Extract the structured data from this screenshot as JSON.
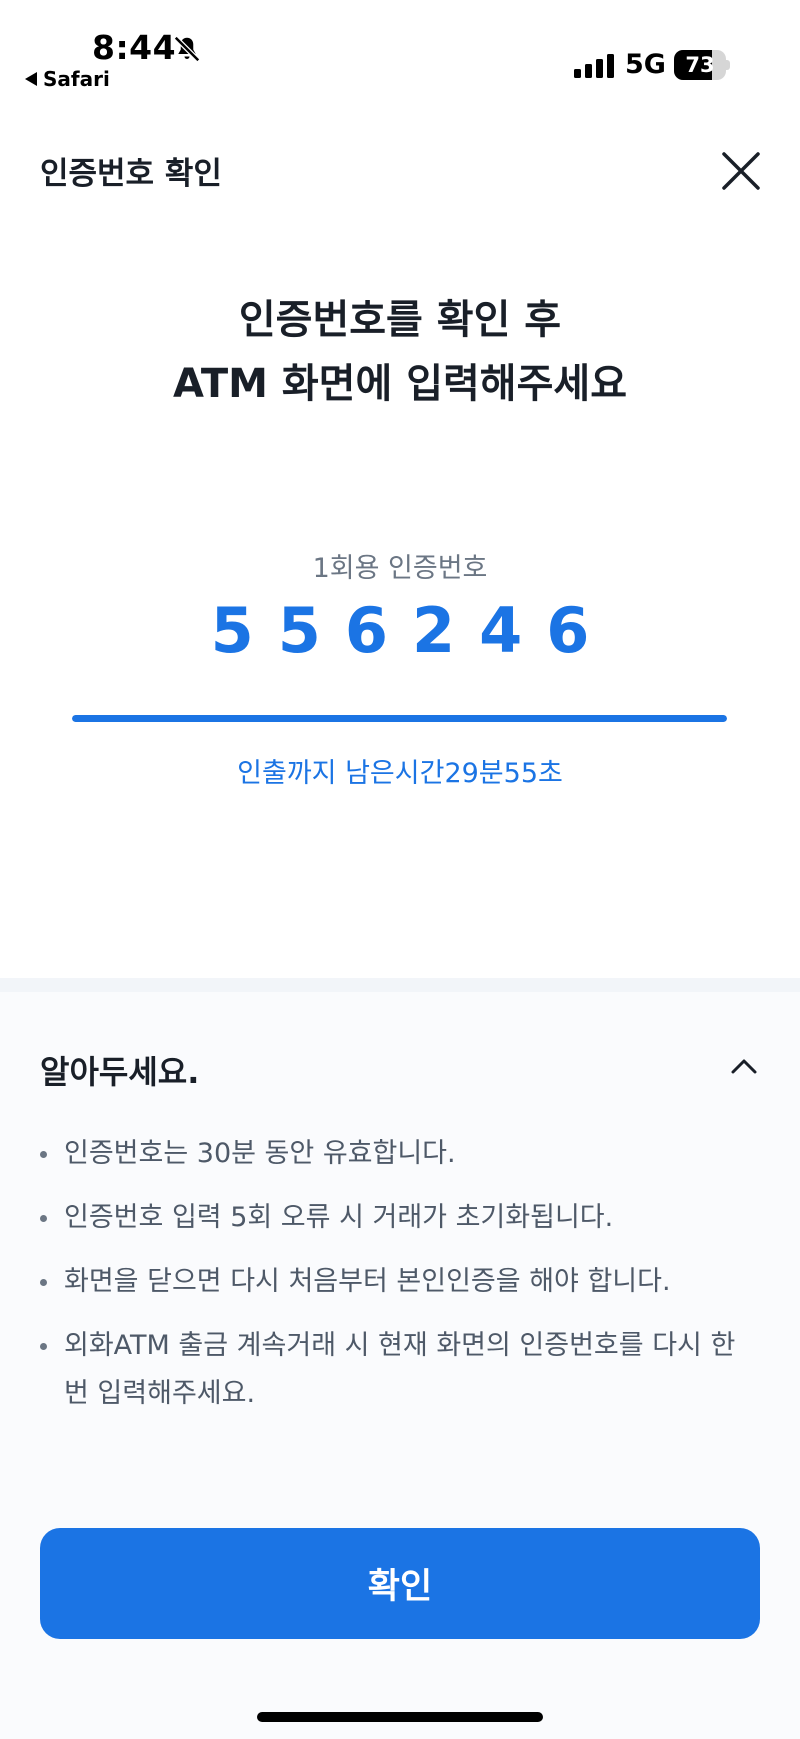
{
  "status_bar": {
    "time": "8:44",
    "back_app": "Safari",
    "network": "5G",
    "battery": "73",
    "battery_level": 0.73,
    "silent_icon": "bell-slash-icon",
    "signal_icon": "cellular-signal-icon"
  },
  "header": {
    "title": "인증번호 확인",
    "close_icon": "close-icon"
  },
  "headline": {
    "line1": "인증번호를 확인 후",
    "line2": "ATM 화면에 입력해주세요"
  },
  "code": {
    "label": "1회용 인증번호",
    "value": "556246"
  },
  "timer": {
    "text": "인출까지 남은시간29분55초",
    "progress": 1.0
  },
  "notice": {
    "title": "알아두세요.",
    "toggle_icon": "chevron-up-icon",
    "items": [
      "인증번호는 30분 동안 유효합니다.",
      "인증번호 입력 5회 오류 시 거래가 초기화됩니다.",
      "화면을 닫으면 다시 처음부터 본인인증을 해야 합니다.",
      "외화ATM 출금 계속거래 시 현재 화면의 인증번호를 다시 한 번 입력해주세요."
    ]
  },
  "confirm_button": {
    "label": "확인"
  },
  "colors": {
    "accent": "#1b74e4",
    "text_primary": "#191f28",
    "text_secondary": "#4e5968",
    "divider": "#f2f5f9"
  }
}
